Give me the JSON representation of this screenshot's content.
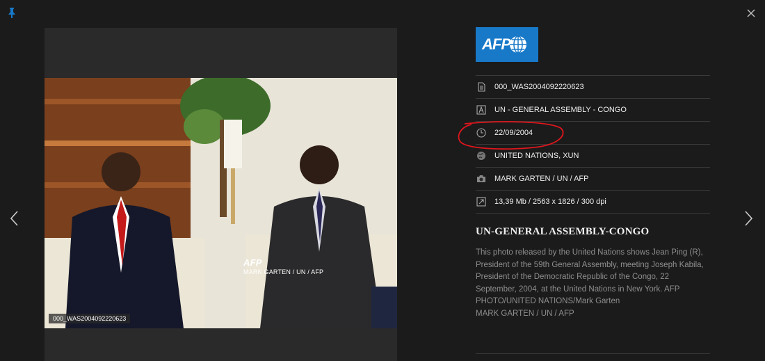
{
  "logo": {
    "text": "AFP",
    "color": "#1879c8"
  },
  "photo": {
    "watermark_logo": "AFP",
    "watermark_credit": "MARK GARTEN / UN / AFP",
    "id_tag": "000_WAS2004092220623"
  },
  "meta": [
    {
      "icon": "document-icon",
      "text": "000_WAS2004092220623"
    },
    {
      "icon": "letter-a-icon",
      "text": "UN - GENERAL ASSEMBLY - CONGO"
    },
    {
      "icon": "clock-icon",
      "text": "22/09/2004"
    },
    {
      "icon": "globe-icon",
      "text": "UNITED NATIONS, XUN"
    },
    {
      "icon": "camera-icon",
      "text": "MARK GARTEN / UN / AFP"
    },
    {
      "icon": "resize-icon",
      "text": "13,39 Mb / 2563 x 1826 / 300 dpi"
    }
  ],
  "title": "UN-GENERAL ASSEMBLY-CONGO",
  "caption": "This photo released by the United Nations shows Jean Ping (R), President of the 59th General Assembly, meeting Joseph Kabila, President of the Democratic Republic of the Congo, 22 September, 2004, at the United Nations in New York. AFP PHOTO/UNITED NATIONS/Mark Garten",
  "caption_credit": "MARK GARTEN / UN / AFP",
  "accent_color": "#1879c8",
  "annotation_color": "#e0161c"
}
